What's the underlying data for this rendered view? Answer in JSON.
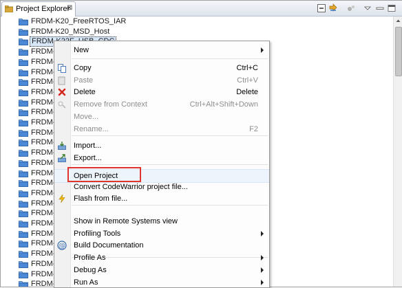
{
  "view": {
    "tab_label": "Project Explorer",
    "close_glyph": "⊠",
    "toolbar": [
      "collapse-all-icon",
      "link-with-editor-icon",
      "view-settings-icon",
      "view-menu-icon",
      "minimize-icon",
      "maximize-icon"
    ]
  },
  "tree": {
    "items": [
      "FRDM-K20_FreeRTOS_IAR",
      "FRDM-K20_MSD_Host",
      "FRDM-K22F_USB_CDC",
      "FRDM-K",
      "FRDM-K",
      "FRDM-K",
      "FRDM-K",
      "FRDM-K",
      "FRDM-K",
      "FRDM-K",
      "FRDM-K",
      "FRDM-K",
      "FRDM-K",
      "FRDM-K",
      "FRDM-K",
      "FRDM-K",
      "FRDM-K",
      "FRDM-K",
      "FRDM-K",
      "FRDM-K",
      "FRDM-K",
      "FRDM-K",
      "FRDM-K",
      "FRDM-K",
      "FRDM-K",
      "FRDM-K",
      "FRDM-K"
    ],
    "selected_index": 2
  },
  "menu": {
    "items": [
      {
        "label": "New",
        "shortcut": "",
        "submenu": true
      },
      {
        "label": "Copy",
        "shortcut": "Ctrl+C"
      },
      {
        "label": "Paste",
        "shortcut": "Ctrl+V"
      },
      {
        "label": "Delete",
        "shortcut": "Delete"
      },
      {
        "label": "Remove from Context",
        "shortcut": "Ctrl+Alt+Shift+Down"
      },
      {
        "label": "Move...",
        "shortcut": ""
      },
      {
        "label": "Rename...",
        "shortcut": "F2"
      },
      {
        "label": "Import...",
        "shortcut": ""
      },
      {
        "label": "Export...",
        "shortcut": ""
      },
      {
        "label": "Open Project",
        "shortcut": ""
      },
      {
        "label": "Convert CodeWarrior project file...",
        "shortcut": ""
      },
      {
        "label": "Flash from file...",
        "shortcut": ""
      },
      {
        "label": "Show in Remote Systems view",
        "shortcut": ""
      },
      {
        "label": "Profiling Tools",
        "shortcut": "",
        "submenu": true
      },
      {
        "label": "Build Documentation",
        "shortcut": ""
      },
      {
        "label": "Profile As",
        "shortcut": "",
        "submenu": true
      },
      {
        "label": "Debug As",
        "shortcut": "",
        "submenu": true
      },
      {
        "label": "Run As",
        "shortcut": "",
        "submenu": true
      }
    ],
    "disabled": [
      "Paste",
      "Remove from Context",
      "Move...",
      "Rename..."
    ],
    "highlighted_item": "Open Project",
    "highlight_color": "#e2342e"
  },
  "colors": {
    "folder": "#3a78c9",
    "delete_icon": "#d2281f",
    "flash_icon": "#f2b600",
    "selection": "#d7e7f8"
  }
}
